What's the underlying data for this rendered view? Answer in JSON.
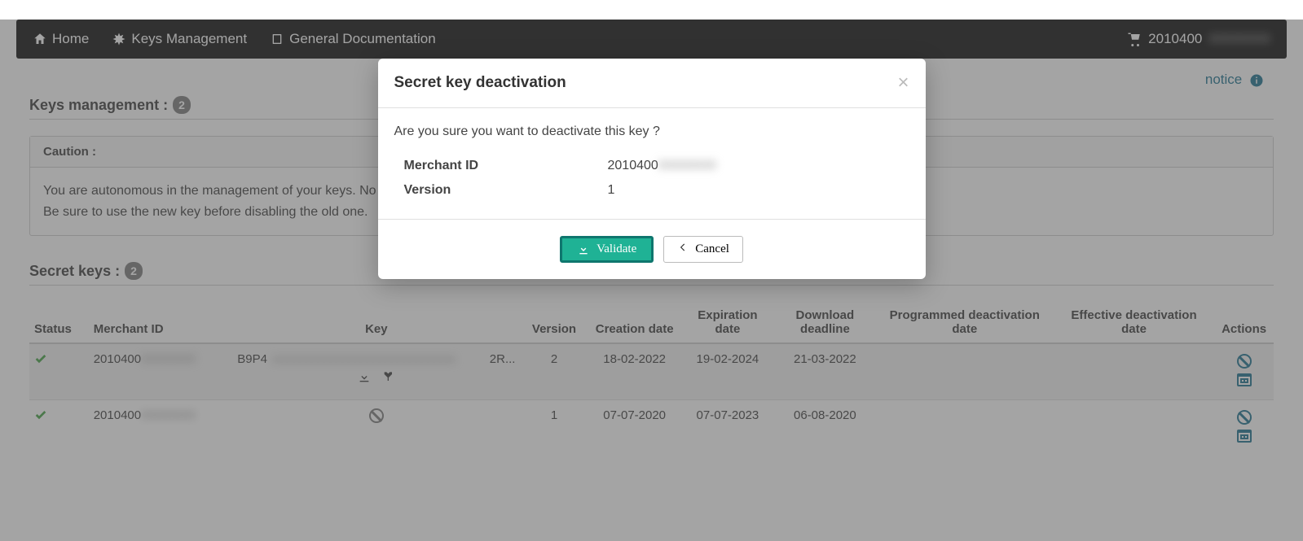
{
  "nav": {
    "home": "Home",
    "keys_mgmt": "Keys Management",
    "general_doc": "General Documentation",
    "cart_id": "2010400"
  },
  "notice": {
    "label": "notice"
  },
  "sections": {
    "keys_mgmt_heading": "Keys management :",
    "keys_mgmt_count": "2",
    "secret_keys_heading": "Secret keys :",
    "secret_keys_count": "2"
  },
  "caution": {
    "header": "Caution :",
    "line1": "You are autonomous in the management of your keys. No request sent to Worldline by email, mail or phone will be taken into account.",
    "line2": "Be sure to use the new key before disabling the old one."
  },
  "table": {
    "headers": {
      "status": "Status",
      "merchant_id": "Merchant ID",
      "key": "Key",
      "version": "Version",
      "creation": "Creation date",
      "expiration": "Expiration date",
      "download": "Download deadline",
      "prog_deact": "Programmed deactivation date",
      "eff_deact": "Effective deactivation date",
      "actions": "Actions"
    },
    "rows": [
      {
        "merchant_id": "2010400",
        "key_prefix": "B9P4",
        "key_suffix": "2R...",
        "version": "2",
        "creation": "18-02-2022",
        "expiration": "19-02-2024",
        "download": "21-03-2022",
        "prog_deact": "",
        "eff_deact": "",
        "has_key_icons": true
      },
      {
        "merchant_id": "2010400",
        "key_prefix": "",
        "key_suffix": "",
        "version": "1",
        "creation": "07-07-2020",
        "expiration": "07-07-2023",
        "download": "06-08-2020",
        "prog_deact": "",
        "eff_deact": "",
        "has_key_icons": false
      }
    ]
  },
  "modal": {
    "title": "Secret key deactivation",
    "question": "Are you sure you want to deactivate this key ?",
    "merchant_id_label": "Merchant ID",
    "merchant_id_value": "2010400",
    "version_label": "Version",
    "version_value": "1",
    "validate": "Validate",
    "cancel": "Cancel"
  }
}
